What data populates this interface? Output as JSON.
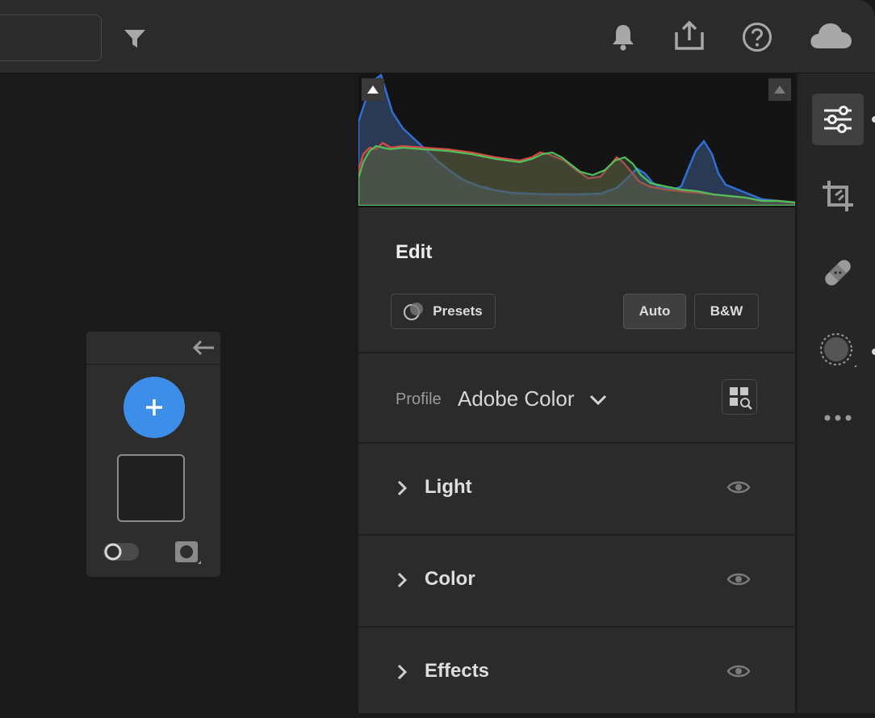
{
  "toolbar": {
    "filter_icon": "funnel-icon",
    "right_icons": [
      "bell-icon",
      "share-icon",
      "help-icon",
      "cloud-icon"
    ]
  },
  "mask_panel": {
    "back_icon": "arrow-left-icon",
    "add_icon": "plus-icon",
    "toggle_on": false
  },
  "edit": {
    "title": "Edit",
    "presets_label": "Presets",
    "auto_label": "Auto",
    "bw_label": "B&W",
    "profile_label": "Profile",
    "profile_value": "Adobe Color",
    "sections": [
      {
        "label": "Light"
      },
      {
        "label": "Color"
      },
      {
        "label": "Effects"
      }
    ]
  },
  "rail": {
    "tools": [
      "edit-sliders-icon",
      "crop-icon",
      "healing-icon",
      "masking-icon",
      "more-icon"
    ],
    "active_tool": "edit-sliders-icon"
  },
  "colors": {
    "accent": "#3d8ee8",
    "hist_red": "#d94848",
    "hist_green": "#4fbf5a",
    "hist_blue": "#2f6fd6"
  }
}
